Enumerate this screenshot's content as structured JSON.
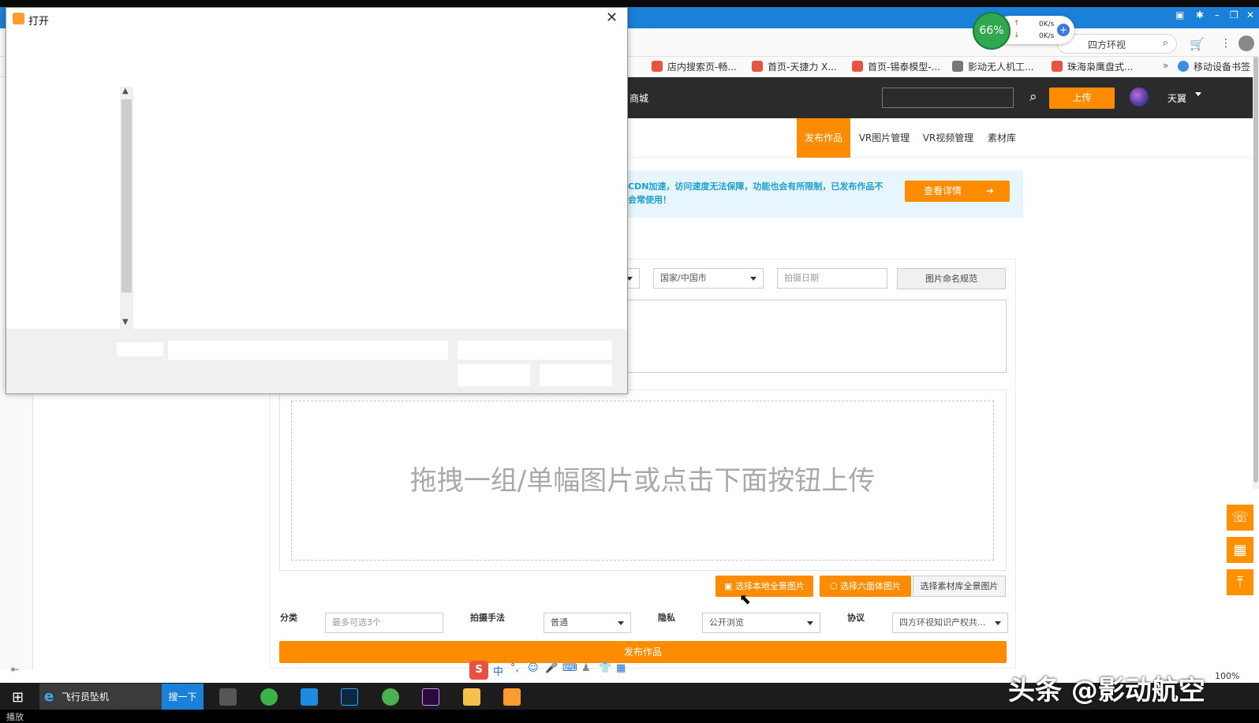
{
  "browser": {
    "speed_percent": "66%",
    "upload_speed": "0K/s",
    "download_speed": "0K/s",
    "search_text": "四方环视",
    "bookmarks": [
      "店内搜索页-畅...",
      "首页-天捷力 X...",
      "首页-锡泰模型-...",
      "影动无人机工...",
      "珠海枭鹰盘式...",
      "移动设备书签"
    ],
    "bookmark_more": "»"
  },
  "site": {
    "brand_partial": "商城",
    "upload_label": "上传",
    "user_name": "天翼",
    "nav_tabs": [
      "发布作品",
      "VR图片管理",
      "VR视频管理",
      "素材库"
    ],
    "notice_text": "CDN加速，访问速度无法保障，功能也会有所限制，已发布作品不会常使用！",
    "notice_button": "查看详情",
    "country_select": "国家/中国市",
    "date_placeholder": "拍摄日期",
    "naming_rule_button": "图片命名规范",
    "drop_text": "拖拽一组/单幅图片或点击下面按钮上传",
    "btn_local_panorama": "选择本地全景图片",
    "btn_cube": "选择六面体图片",
    "btn_library": "选择素材库全景图片",
    "label_category": "分类",
    "category_placeholder": "最多可选3个",
    "label_technique": "拍摄手法",
    "technique_value": "普通",
    "label_privacy": "隐私",
    "privacy_value": "公开浏览",
    "label_agreement": "协议",
    "agreement_value": "四方环视知识产权共...",
    "publish_button": "发布作品"
  },
  "dialog": {
    "title": "打开"
  },
  "taskbar": {
    "ie_label": "飞行员坠机",
    "search_button": "搜一下",
    "ime_mode": "中",
    "zoom": "100%"
  },
  "bottom": {
    "status": "播放"
  },
  "watermark": "头条 @影动航空",
  "colors": {
    "accent": "#ff8c00",
    "header": "#2b2b2b",
    "notice_bg": "#e6f6fc",
    "notice_text": "#1d9fd1"
  }
}
